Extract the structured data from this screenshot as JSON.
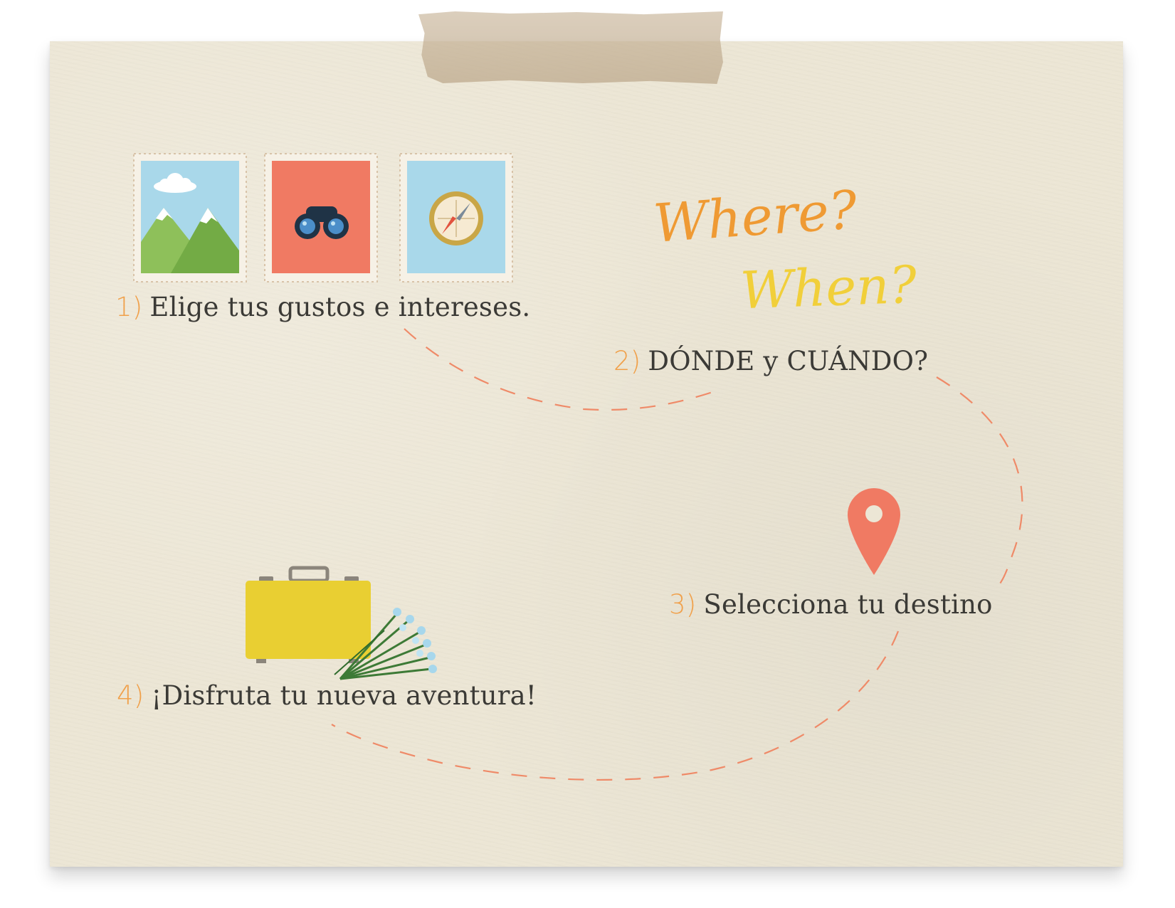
{
  "steps": [
    {
      "number": "1)",
      "text": "Elige tus gustos e intereses."
    },
    {
      "number": "2)",
      "text": "DÓNDE y CUÁNDO?"
    },
    {
      "number": "3)",
      "text": "Selecciona tu destino"
    },
    {
      "number": "4)",
      "text": "¡Disfruta tu nueva aventura!"
    }
  ],
  "handwriting": {
    "where": "Where?",
    "when": "When?"
  },
  "stamps": [
    {
      "icon": "mountain-icon",
      "background": "#a9d8ea"
    },
    {
      "icon": "binoculars-icon",
      "background": "#f07a63"
    },
    {
      "icon": "compass-icon",
      "background": "#a9d8ea"
    }
  ],
  "icons": [
    "location-pin-icon",
    "suitcase-icon",
    "flowers-icon"
  ],
  "colors": {
    "paper": "#ece6d5",
    "step_number": "#f0a04a",
    "step_text": "#3b3a36",
    "where": "#ef9a33",
    "when": "#f1cf3a",
    "dashed_path": "#ef8a68",
    "pin": "#f07a63",
    "suitcase": "#e9cf32"
  }
}
